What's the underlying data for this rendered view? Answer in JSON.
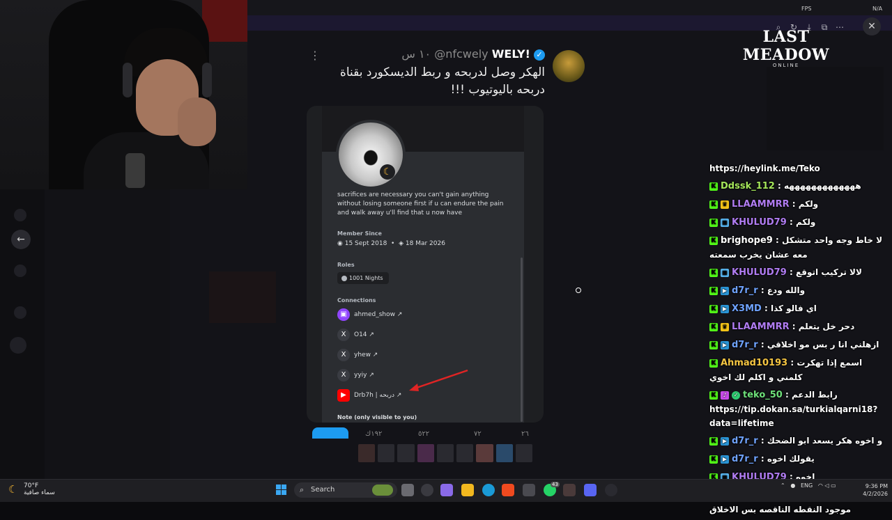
{
  "overlay": {
    "fps_label": "FPS",
    "fps_value": "N/A",
    "logo_title": "LAST MEADOW",
    "logo_subtitle": "ONLINE"
  },
  "tweet": {
    "display_name": "WELY!",
    "handle": "@nfcwely",
    "time": "١٠ س",
    "text": "الهكر وصل لدربحه و ربط الديسكورد بقناة دربحه باليوتيوب !!!",
    "actions": {
      "replies": "٢٦",
      "reposts": "٧٢",
      "likes": "٥٢٢",
      "views": "١٩٢ك"
    }
  },
  "discord_profile": {
    "bio": "sacrifices are necessary you can't gain anything without losing someone first if u can endure the pain and walk away u'll find that u now have",
    "member_since_label": "Member Since",
    "member_since_discord": "15 Sept 2018",
    "member_since_server": "18 Mar 2026",
    "roles_label": "Roles",
    "role": "1001 Nights",
    "connections_label": "Connections",
    "connections": [
      {
        "name": "ahmed_show ↗",
        "icon": "twitch-icon"
      },
      {
        "name": "O14 ↗",
        "icon": "x-icon"
      },
      {
        "name": "yhew ↗",
        "icon": "x-icon"
      },
      {
        "name": "yyiy ↗",
        "icon": "x-icon"
      },
      {
        "name": "Drb7h | دربحه ↗",
        "icon": "youtube-icon"
      }
    ],
    "note_label": "Note (only visible to you)"
  },
  "chat": [
    {
      "badges": [],
      "user": "",
      "color": "#ffffff",
      "text": "https://heylink.me/Teko"
    },
    {
      "badges": [
        "k"
      ],
      "user": "Ddssk_112",
      "color": "#a4e55a",
      "text": "هههههههههههههه"
    },
    {
      "badges": [
        "k",
        "crown"
      ],
      "user": "LLAAMMRR",
      "color": "#b07cf2",
      "text": "ولكم"
    },
    {
      "badges": [
        "k",
        "game"
      ],
      "user": "KHULUD79",
      "color": "#b07cf2",
      "text": "ولكم"
    },
    {
      "badges": [
        "k"
      ],
      "user": "brighope9",
      "color": "#ffffff",
      "text": "لا خاط وجه واحد متشكل معه عشان يخرب سمعته"
    },
    {
      "badges": [
        "k",
        "game"
      ],
      "user": "KHULUD79",
      "color": "#b07cf2",
      "text": "لالا تركيب اتوقع"
    },
    {
      "badges": [
        "k",
        "arrow"
      ],
      "user": "d7r_r",
      "color": "#6fa3ff",
      "text": "والله ودع"
    },
    {
      "badges": [
        "k",
        "arrow"
      ],
      "user": "X3MD",
      "color": "#6fa3ff",
      "text": "اي فالو كذا"
    },
    {
      "badges": [
        "k",
        "crown"
      ],
      "user": "LLAAMMRR",
      "color": "#b07cf2",
      "text": "دحر خل يتعلم"
    },
    {
      "badges": [
        "k",
        "arrow"
      ],
      "user": "d7r_r",
      "color": "#6fa3ff",
      "text": "ازهلني انا ر بس مو اخلاقي"
    },
    {
      "badges": [
        "k"
      ],
      "user": "Ahmad10193",
      "color": "#f5c542",
      "text": "اسمع إذا تهكرت كلمني و اكلم لك اخوي"
    },
    {
      "badges": [
        "k",
        "mic",
        "check"
      ],
      "user": "teko_50",
      "color": "#6ee07a",
      "text": "رابط الدعم https://tip.dokan.sa/turkialqarni18?data=lifetime"
    },
    {
      "badges": [
        "k",
        "arrow"
      ],
      "user": "d7r_r",
      "color": "#6fa3ff",
      "text": "و اخوه هكر يسعد ابو الضحك"
    },
    {
      "badges": [
        "k",
        "arrow"
      ],
      "user": "d7r_r",
      "color": "#6fa3ff",
      "text": "يقولك اخوه"
    },
    {
      "badges": [
        "k",
        "game"
      ],
      "user": "KHULUD79",
      "color": "#b07cf2",
      "text": "اخوه"
    },
    {
      "badges": [
        "k",
        "crown"
      ],
      "user": "LLAAMMRR",
      "color": "#b07cf2",
      "text": "معليك معليك دحر موجود النقطه الناقصه بس الاخلاق"
    }
  ],
  "taskbar": {
    "temperature": "70°F",
    "weather_text": "سماء صافية",
    "search_placeholder": "Search",
    "language": "ENG",
    "time": "9:36 PM",
    "date": "4/2/2026",
    "badge_count": "43"
  }
}
